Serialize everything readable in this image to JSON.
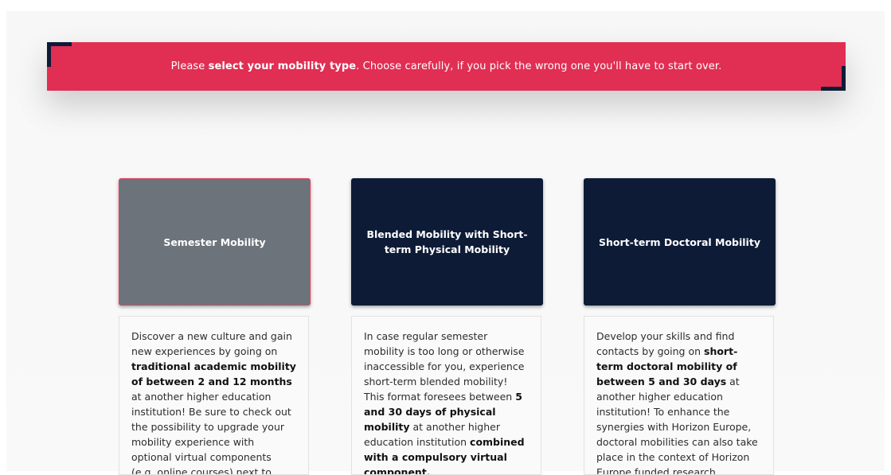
{
  "banner": {
    "pre": "Please ",
    "bold": "select your mobility type",
    "post": ". Choose carefully, if you pick the wrong one you'll have to start over."
  },
  "colors": {
    "accent": "#e12e53",
    "navy": "#0d1b36",
    "selected_card": "#6c737b"
  },
  "cards": [
    {
      "title": "Semester Mobility",
      "selected": true,
      "description": [
        {
          "t": "Discover a new culture and gain new experiences by going on "
        },
        {
          "t": "traditional academic mobility of between 2 and 12 months",
          "b": true
        },
        {
          "t": " at another higher education institution! Be sure to check out the possibility to upgrade your mobility experience with optional virtual components (e.g. online courses) next to your academic mobility."
        }
      ]
    },
    {
      "title": "Blended Mobility with Short-term Physical Mobility",
      "selected": false,
      "description": [
        {
          "t": "In case regular semester mobility is too long or otherwise inaccessible for you, experience short-term blended mobility! This format foresees between "
        },
        {
          "t": "5 and 30 days of physical mobility",
          "b": true
        },
        {
          "t": " at another higher education institution "
        },
        {
          "t": "combined with a compulsory virtual component.",
          "b": true
        }
      ]
    },
    {
      "title": "Short-term Doctoral Mobility",
      "selected": false,
      "description": [
        {
          "t": "Develop your skills and find contacts by going on "
        },
        {
          "t": "short-term doctoral mobility of between 5 and 30 days",
          "b": true
        },
        {
          "t": " at another higher education institution! To enhance the synergies with Horizon Europe, doctoral mobilities can also take place in the context of Horizon Europe funded research projects."
        }
      ]
    }
  ]
}
